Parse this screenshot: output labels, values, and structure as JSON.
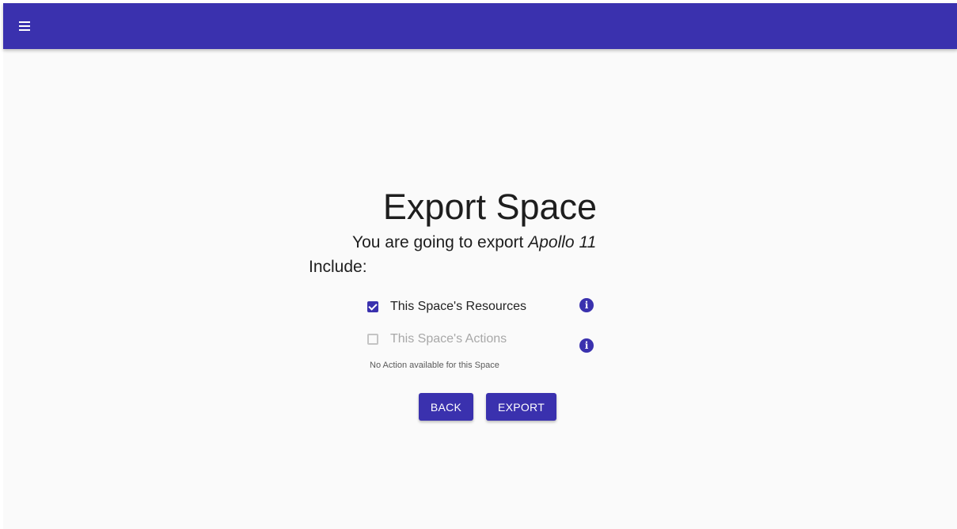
{
  "appbar": {
    "menu_icon": "menu-icon",
    "color": "#3a31ae"
  },
  "page": {
    "title": "Export Space",
    "subtitle_prefix": "You are going to export",
    "space_name": "Apollo 11",
    "include_label": "Include:"
  },
  "options": {
    "resources": {
      "label": "This Space's Resources",
      "checked": true,
      "info_icon": "info-icon"
    },
    "actions": {
      "label": "This Space's Actions",
      "checked": false,
      "disabled": true,
      "helper_text": "No Action available for this Space",
      "info_icon": "info-icon"
    }
  },
  "buttons": {
    "back_label": "BACK",
    "export_label": "EXPORT"
  }
}
